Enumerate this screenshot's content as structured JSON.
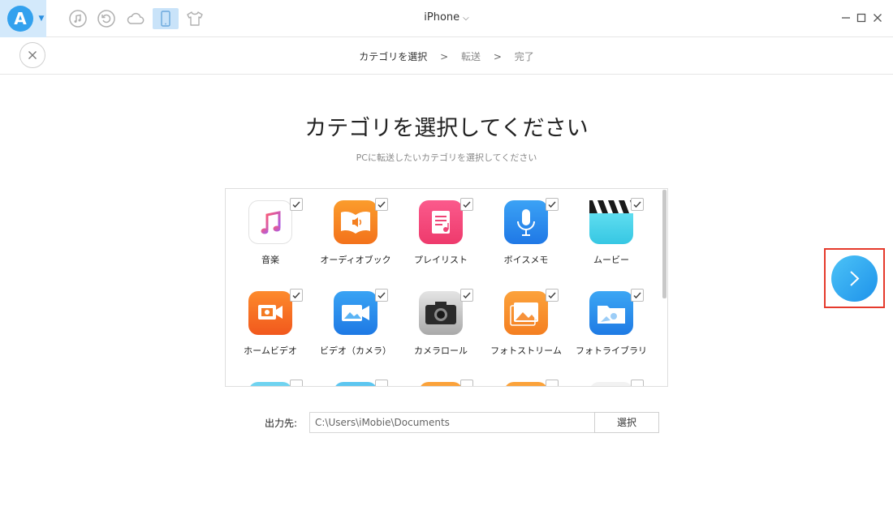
{
  "titlebar": {
    "device_name": "iPhone",
    "tools": [
      "music-icon",
      "restore-icon",
      "cloud-icon",
      "iphone-icon",
      "tshirt-icon"
    ]
  },
  "steps": {
    "current": "カテゴリを選択",
    "step2": "転送",
    "step3": "完了",
    "separator": ">"
  },
  "main": {
    "title": "カテゴリを選択してください",
    "subtitle": "PCに転送したいカテゴリを選択してください"
  },
  "categories": [
    {
      "label": "音楽",
      "icon": "music-icon",
      "checked": true
    },
    {
      "label": "オーディオブック",
      "icon": "audiobook-icon",
      "checked": true
    },
    {
      "label": "プレイリスト",
      "icon": "playlist-icon",
      "checked": true
    },
    {
      "label": "ボイスメモ",
      "icon": "voice-memo-icon",
      "checked": true
    },
    {
      "label": "ムービー",
      "icon": "movie-icon",
      "checked": true
    },
    {
      "label": "ホームビデオ",
      "icon": "home-video-icon",
      "checked": true
    },
    {
      "label": "ビデオ（カメラ）",
      "icon": "camera-video-icon",
      "checked": true
    },
    {
      "label": "カメラロール",
      "icon": "camera-roll-icon",
      "checked": true
    },
    {
      "label": "フォトストリーム",
      "icon": "photo-stream-icon",
      "checked": true
    },
    {
      "label": "フォトライブラリ",
      "icon": "photo-library-icon",
      "checked": true
    }
  ],
  "output": {
    "label": "出力先:",
    "path": "C:\\Users\\iMobie\\Documents",
    "button": "選択"
  },
  "colors": {
    "accent": "#1e92ea",
    "highlight_border": "#e53a2c"
  }
}
